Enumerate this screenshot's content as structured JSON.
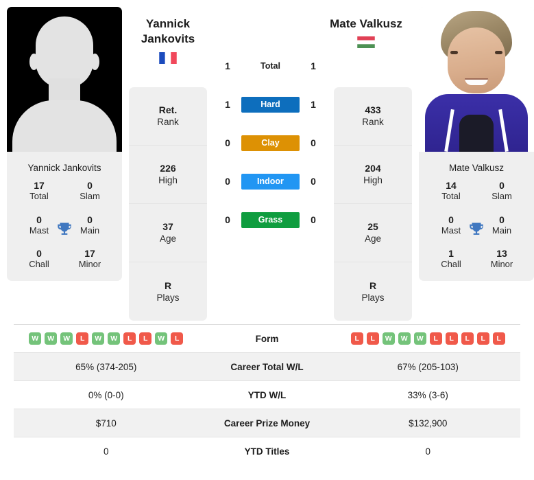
{
  "players": {
    "left": {
      "first_name": "Yannick",
      "last_name": "Jankovits",
      "full_name": "Yannick Jankovits",
      "country": "France",
      "flag_icon": "flag-france",
      "photo_type": "silhouette-avatar",
      "rank": "Ret.",
      "rank_label": "Rank",
      "high": "226",
      "high_label": "High",
      "age": "37",
      "age_label": "Age",
      "plays": "R",
      "plays_label": "Plays",
      "titles": {
        "total": "17",
        "total_label": "Total",
        "slam": "0",
        "slam_label": "Slam",
        "mast": "0",
        "mast_label": "Mast",
        "main": "0",
        "main_label": "Main",
        "chall": "0",
        "chall_label": "Chall",
        "minor": "17",
        "minor_label": "Minor"
      },
      "surface_wins": {
        "total": "1",
        "hard": "1",
        "clay": "0",
        "indoor": "0",
        "grass": "0"
      },
      "form": [
        "W",
        "W",
        "W",
        "L",
        "W",
        "W",
        "L",
        "L",
        "W",
        "L"
      ],
      "career_wl": "65% (374-205)",
      "ytd_wl": "0% (0-0)",
      "career_prize": "$710",
      "ytd_titles": "0"
    },
    "right": {
      "first_name": "Mate",
      "last_name": "Valkusz",
      "full_name": "Mate Valkusz",
      "country": "Hungary",
      "flag_icon": "flag-hungary",
      "photo_type": "portrait-photo",
      "rank": "433",
      "rank_label": "Rank",
      "high": "204",
      "high_label": "High",
      "age": "25",
      "age_label": "Age",
      "plays": "R",
      "plays_label": "Plays",
      "titles": {
        "total": "14",
        "total_label": "Total",
        "slam": "0",
        "slam_label": "Slam",
        "mast": "0",
        "mast_label": "Mast",
        "main": "0",
        "main_label": "Main",
        "chall": "1",
        "chall_label": "Chall",
        "minor": "13",
        "minor_label": "Minor"
      },
      "surface_wins": {
        "total": "1",
        "hard": "1",
        "clay": "0",
        "indoor": "0",
        "grass": "0"
      },
      "form": [
        "L",
        "L",
        "W",
        "W",
        "W",
        "L",
        "L",
        "L",
        "L",
        "L"
      ],
      "career_wl": "67% (205-103)",
      "ytd_wl": "33% (3-6)",
      "career_prize": "$132,900",
      "ytd_titles": "0"
    }
  },
  "surfaces": [
    {
      "key": "total",
      "label": "Total",
      "color": "transparent",
      "text_color": "#1d1d1d"
    },
    {
      "key": "hard",
      "label": "Hard",
      "color": "#0d6ebd",
      "text_color": "#ffffff"
    },
    {
      "key": "clay",
      "label": "Clay",
      "color": "#dd9104",
      "text_color": "#ffffff"
    },
    {
      "key": "indoor",
      "label": "Indoor",
      "color": "#2196f3",
      "text_color": "#ffffff"
    },
    {
      "key": "grass",
      "label": "Grass",
      "color": "#0f9d3f",
      "text_color": "#ffffff"
    }
  ],
  "table_rows": [
    {
      "key": "form",
      "label": "Form",
      "type": "form"
    },
    {
      "key": "career_wl",
      "label": "Career Total W/L",
      "type": "text"
    },
    {
      "key": "ytd_wl",
      "label": "YTD W/L",
      "type": "text"
    },
    {
      "key": "career_prize",
      "label": "Career Prize Money",
      "type": "text"
    },
    {
      "key": "ytd_titles",
      "label": "YTD Titles",
      "type": "text"
    }
  ],
  "colors": {
    "win_badge": "#74c37a",
    "loss_badge": "#f0594a",
    "card_bg": "#efefef",
    "row_shade": "#f1f1f1",
    "trophy": "#3f77c0",
    "hard": "#0d6ebd",
    "clay": "#dd9104",
    "indoor": "#2196f3",
    "grass": "#0f9d3f"
  },
  "icons": {
    "trophy": "trophy-icon",
    "flag_left": "flag-france-icon",
    "flag_right": "flag-hungary-icon"
  }
}
